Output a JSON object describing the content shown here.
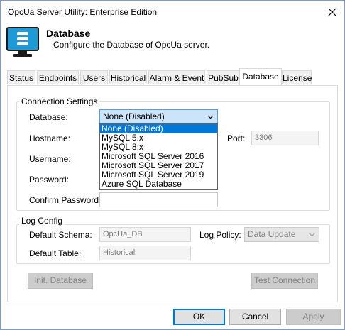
{
  "window": {
    "title": "OpcUa Server Utility: Enterprise Edition",
    "close_icon": "close-icon"
  },
  "header": {
    "icon": "database-monitor-icon",
    "title": "Database",
    "subtitle": "Configure the Database of OpcUa server."
  },
  "tabs": [
    {
      "label": "Status"
    },
    {
      "label": "Endpoints"
    },
    {
      "label": "Users"
    },
    {
      "label": "Historical"
    },
    {
      "label": "Alarm & Event"
    },
    {
      "label": "PubSub"
    },
    {
      "label": "Database",
      "active": true
    },
    {
      "label": "License"
    }
  ],
  "connection": {
    "legend": "Connection Settings",
    "database_label": "Database:",
    "database_value": "None (Disabled)",
    "hostname_label": "Hostname:",
    "port_label": "Port:",
    "port_value": "3306",
    "username_label": "Username:",
    "password_label": "Password:",
    "confirm_password_label": "Confirm Password:"
  },
  "dropdown_options": [
    "None (Disabled)",
    "MySQL 5.x",
    "MySQL 8.x",
    "Microsoft SQL Server 2016",
    "Microsoft SQL Server 2017",
    "Microsoft SQL Server 2019",
    "Azure SQL Database"
  ],
  "dropdown_selected": "None (Disabled)",
  "log": {
    "legend": "Log Config",
    "schema_label": "Default Schema:",
    "schema_value": "OpcUa_DB",
    "table_label": "Default Table:",
    "table_value": "Historical",
    "policy_label": "Log Policy:",
    "policy_value": "Data Update"
  },
  "buttons": {
    "init_db": "Init. Database",
    "test_conn": "Test Connection",
    "ok": "OK",
    "cancel": "Cancel",
    "apply": "Apply"
  },
  "colors": {
    "accent": "#0078d7",
    "combo_bg": "#cce4f7",
    "monitor": "#1e9ad6"
  }
}
